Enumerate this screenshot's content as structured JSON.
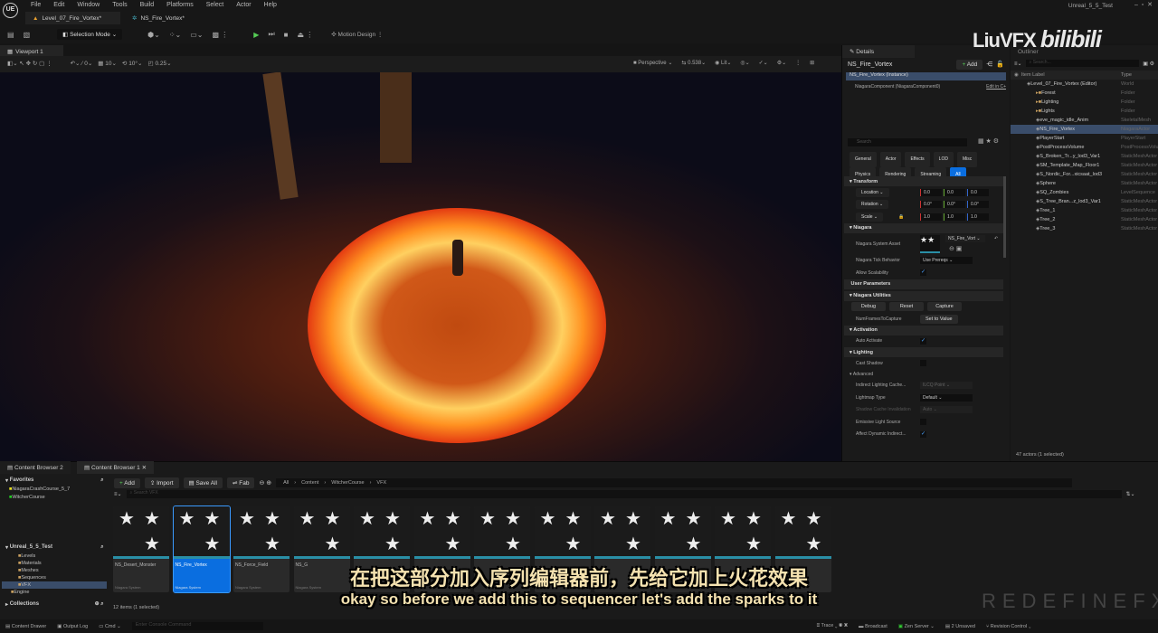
{
  "app": {
    "logo": "UE",
    "menu": [
      "File",
      "Edit",
      "Window",
      "Tools",
      "Build",
      "Platforms",
      "Select",
      "Actor",
      "Help"
    ],
    "window_title": "Unreal_5_5_Test",
    "doc_tabs": [
      "Level_07_Fire_Vortex*",
      "NS_Fire_Vortex*"
    ]
  },
  "toolbar": {
    "selection_mode": "Selection Mode",
    "motion_design": "Motion Design"
  },
  "viewport": {
    "tab": "Viewport 1",
    "snap_translate": "10",
    "snap_rotate": "10°",
    "snap_scale": "0.25",
    "perspective": "Perspective",
    "fov": "0.538",
    "lit": "Lit",
    "grid_value": "0"
  },
  "details": {
    "tab": "Details",
    "title": "NS_Fire_Vortex",
    "add": "Add",
    "instance": "NS_Fire_Vortex (Instance)",
    "component": "NiagaraComponent (NiagaraComponent0)",
    "edit_link": "Edit in C+",
    "search_placeholder": "Search",
    "filters": [
      "General",
      "Actor",
      "Effects",
      "LOD",
      "Misc",
      "Physics",
      "Rendering",
      "Streaming",
      "All"
    ],
    "active_filter": "All",
    "transform": {
      "header": "Transform",
      "location": {
        "label": "Location",
        "values": [
          "0.0",
          "0.0",
          "0.0"
        ]
      },
      "rotation": {
        "label": "Rotation",
        "values": [
          "0.0°",
          "0.0°",
          "0.0°"
        ]
      },
      "scale": {
        "label": "Scale",
        "values": [
          "1.0",
          "1.0",
          "1.0"
        ]
      }
    },
    "niagara": {
      "header": "Niagara",
      "system_asset_label": "Niagara System Asset",
      "system_asset": "NS_Fire_Vort",
      "tick_label": "Niagara Tick Behavior",
      "tick_value": "Use Prereqs",
      "scalability_label": "Allow Scalability",
      "scalability": true
    },
    "user_params": "User Parameters",
    "utilities": {
      "header": "Niagara Utilities",
      "debug": "Debug",
      "reset": "Reset",
      "capture": "Capture",
      "frames_label": "NumFramesToCapture",
      "set_value": "Set to Value"
    },
    "activation": {
      "header": "Activation",
      "auto_label": "Auto Activate",
      "auto": true
    },
    "lighting": {
      "header": "Lighting",
      "cast_shadow": "Cast Shadow",
      "cast_shadow_checked": false,
      "advanced": "Advanced",
      "ilc_label": "Indirect Lighting Cache...",
      "ilc_value": "ILCQ Point",
      "lightmap_label": "Lightmap Type",
      "lightmap_value": "Default",
      "shadow_label": "Shadow Cache Invalidation",
      "shadow_value": "Auto",
      "emissive_label": "Emissive Light Source",
      "emissive": false,
      "affect_label": "Affect Dynamic Indirect...",
      "affect": true
    }
  },
  "outliner": {
    "tab": "Outliner",
    "search_placeholder": "Search...",
    "col_label": "Item Label",
    "col_type": "Type",
    "items": [
      {
        "label": "Level_07_Fire_Vortex (Editor)",
        "type": "World",
        "indent": 0
      },
      {
        "label": "Forest",
        "type": "Folder",
        "indent": 1
      },
      {
        "label": "Lighting",
        "type": "Folder",
        "indent": 1
      },
      {
        "label": "Lights",
        "type": "Folder",
        "indent": 1
      },
      {
        "label": "eve_magic_idle_Anim",
        "type": "SkeletalMesh",
        "indent": 1
      },
      {
        "label": "NS_Fire_Vortex",
        "type": "NiagaraActor",
        "indent": 1,
        "selected": true
      },
      {
        "label": "PlayerStart",
        "type": "PlayerStart",
        "indent": 1
      },
      {
        "label": "PostProcessVolume",
        "type": "PostProcessVolume",
        "indent": 1
      },
      {
        "label": "S_Broken_Tr...y_lod3_Var1",
        "type": "StaticMeshActor",
        "indent": 1
      },
      {
        "label": "SM_Template_Map_Floor1",
        "type": "StaticMeshActor",
        "indent": 1
      },
      {
        "label": "S_Nordic_For...xicsaat_lod3",
        "type": "StaticMeshActor",
        "indent": 1
      },
      {
        "label": "Sphere",
        "type": "StaticMeshActor",
        "indent": 1
      },
      {
        "label": "SQ_Zombies",
        "type": "LevelSequence",
        "indent": 1
      },
      {
        "label": "S_Tree_Bran...z_lod3_Var1",
        "type": "StaticMeshActor",
        "indent": 1
      },
      {
        "label": "Tree_1",
        "type": "StaticMeshActor",
        "indent": 1
      },
      {
        "label": "Tree_2",
        "type": "StaticMeshActor",
        "indent": 1
      },
      {
        "label": "Tree_3",
        "type": "StaticMeshActor",
        "indent": 1
      }
    ],
    "count": "47 actors (1 selected)"
  },
  "content": {
    "tabs": [
      "Content Browser 2",
      "Content Browser 1"
    ],
    "add": "Add",
    "import": "Import",
    "save_all": "Save All",
    "fab": "Fab",
    "path": [
      "All",
      "Content",
      "WitcherCourse",
      "VFX"
    ],
    "search_placeholder": "Search VFX",
    "favorites": "Favorites",
    "fav_items": [
      "NiagaraCrashCourse_5_7",
      "WitcherCourse"
    ],
    "project": "Unreal_5_5_Test",
    "folders": [
      "Levels",
      "Materials",
      "Meshes",
      "Sequences",
      "VFX",
      "Engine"
    ],
    "collections": "Collections",
    "assets": [
      {
        "name": "NS_Desert_Monster",
        "type": "Niagara System"
      },
      {
        "name": "NS_Fire_Vortex",
        "type": "Niagara System",
        "selected": true
      },
      {
        "name": "NS_Force_Field",
        "type": "Niagara System"
      },
      {
        "name": "NS_G",
        "type": "Niagara System"
      },
      {
        "name": "",
        "type": ""
      },
      {
        "name": "",
        "type": ""
      },
      {
        "name": "",
        "type": ""
      },
      {
        "name": "",
        "type": ""
      },
      {
        "name": "",
        "type": ""
      },
      {
        "name": "",
        "type": ""
      },
      {
        "name": "",
        "type": ""
      },
      {
        "name": "",
        "type": ""
      }
    ],
    "status": "12 items (1 selected)"
  },
  "statusbar": {
    "content_drawer": "Content Drawer",
    "output_log": "Output Log",
    "cmd": "Cmd",
    "console_placeholder": "Enter Console Command",
    "trace": "Trace",
    "broadcast": "Broadcast",
    "zen": "Zen Server",
    "unsaved": "2 Unsaved",
    "revision": "Revision Control"
  },
  "subtitles": {
    "zh": "在把这部分加入序列编辑器前，先给它加上火花效果",
    "en": "okay so before we add this to sequencer let's add the sparks to it"
  },
  "watermarks": {
    "top": "LiuVFX bilibili",
    "bottom": "REDEFINEFX"
  }
}
